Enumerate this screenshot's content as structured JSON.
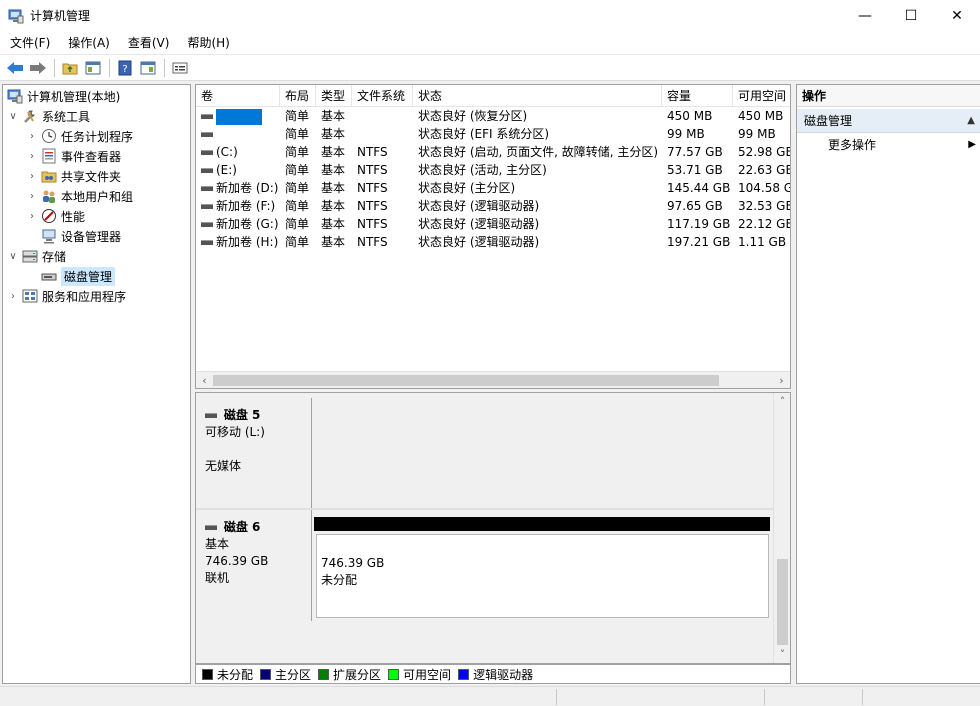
{
  "window": {
    "title": "计算机管理",
    "minimize_glyph": "—",
    "maximize_glyph": "☐",
    "close_glyph": "✕"
  },
  "menu": [
    "文件(F)",
    "操作(A)",
    "查看(V)",
    "帮助(H)"
  ],
  "toolbar": {
    "icons": [
      "back-arrow-icon",
      "forward-arrow-icon",
      "up-folder-icon",
      "show-hide-tree-icon",
      "help-icon",
      "show-hide-action-icon",
      "properties-icon"
    ]
  },
  "tree": {
    "root": "计算机管理(本地)",
    "system_tools": "系统工具",
    "task_scheduler": "任务计划程序",
    "event_viewer": "事件查看器",
    "shared_folders": "共享文件夹",
    "local_users": "本地用户和组",
    "performance": "性能",
    "device_manager": "设备管理器",
    "storage": "存储",
    "disk_management": "磁盘管理",
    "services_apps": "服务和应用程序"
  },
  "volume_list": {
    "headers": [
      "卷",
      "布局",
      "类型",
      "文件系统",
      "状态",
      "容量",
      "可用空间"
    ],
    "rows": [
      {
        "vol": "",
        "layout": "简单",
        "type": "基本",
        "fs": "",
        "status": "状态良好 (恢复分区)",
        "cap": "450 MB",
        "free": "450 MB"
      },
      {
        "vol": "",
        "layout": "简单",
        "type": "基本",
        "fs": "",
        "status": "状态良好 (EFI 系统分区)",
        "cap": "99 MB",
        "free": "99 MB"
      },
      {
        "vol": "(C:)",
        "layout": "简单",
        "type": "基本",
        "fs": "NTFS",
        "status": "状态良好 (启动, 页面文件, 故障转储, 主分区)",
        "cap": "77.57 GB",
        "free": "52.98 GB"
      },
      {
        "vol": "(E:)",
        "layout": "简单",
        "type": "基本",
        "fs": "NTFS",
        "status": "状态良好 (活动, 主分区)",
        "cap": "53.71 GB",
        "free": "22.63 GB"
      },
      {
        "vol": "新加卷 (D:)",
        "layout": "简单",
        "type": "基本",
        "fs": "NTFS",
        "status": "状态良好 (主分区)",
        "cap": "145.44 GB",
        "free": "104.58 G"
      },
      {
        "vol": "新加卷 (F:)",
        "layout": "简单",
        "type": "基本",
        "fs": "NTFS",
        "status": "状态良好 (逻辑驱动器)",
        "cap": "97.65 GB",
        "free": "32.53 GB"
      },
      {
        "vol": "新加卷 (G:)",
        "layout": "简单",
        "type": "基本",
        "fs": "NTFS",
        "status": "状态良好 (逻辑驱动器)",
        "cap": "117.19 GB",
        "free": "22.12 GB"
      },
      {
        "vol": "新加卷 (H:)",
        "layout": "简单",
        "type": "基本",
        "fs": "NTFS",
        "status": "状态良好 (逻辑驱动器)",
        "cap": "197.21 GB",
        "free": "1.11 GB"
      }
    ]
  },
  "disks": {
    "disk5": {
      "name": "磁盘 5",
      "kind": "可移动 (L:)",
      "media": "无媒体"
    },
    "disk6": {
      "name": "磁盘 6",
      "kind": "基本",
      "size": "746.39 GB",
      "state": "联机",
      "part_size": "746.39 GB",
      "part_label": "未分配"
    }
  },
  "legend": [
    {
      "label": "未分配",
      "color": "#000000"
    },
    {
      "label": "主分区",
      "color": "#000080"
    },
    {
      "label": "扩展分区",
      "color": "#008000"
    },
    {
      "label": "可用空间",
      "color": "#00ff00"
    },
    {
      "label": "逻辑驱动器",
      "color": "#0000ff"
    }
  ],
  "actions": {
    "header": "操作",
    "group": "磁盘管理",
    "more": "更多操作"
  }
}
